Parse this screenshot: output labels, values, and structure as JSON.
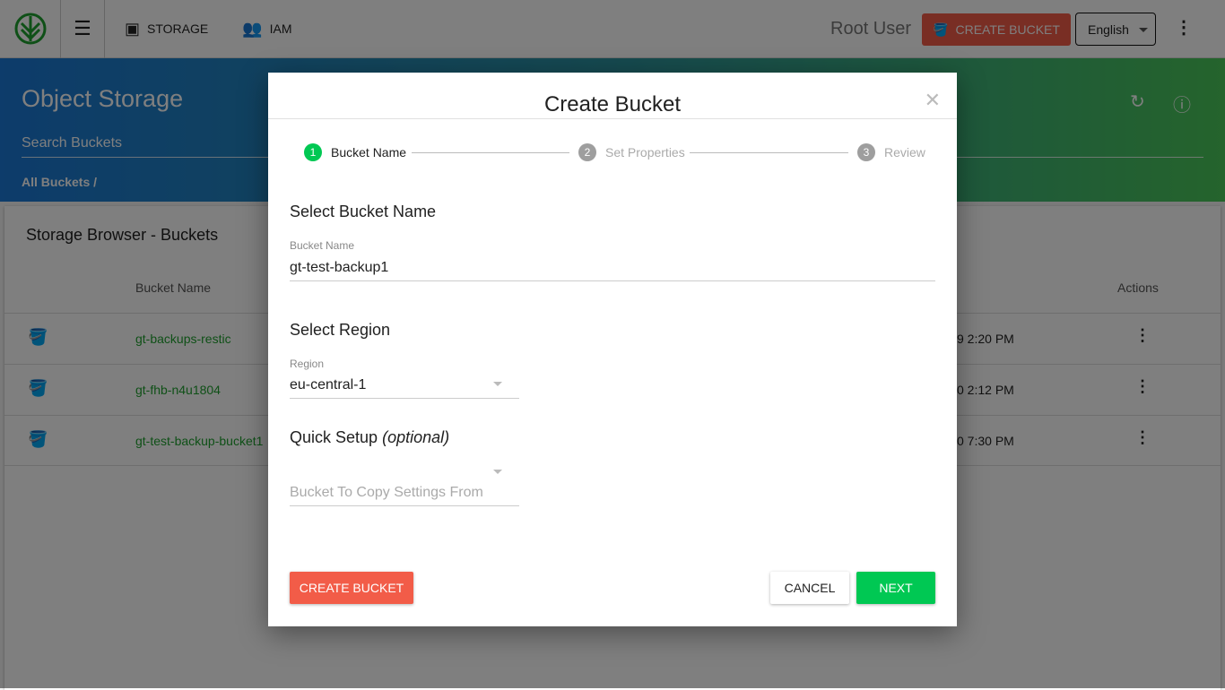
{
  "topbar": {
    "nav": [
      {
        "label": "STORAGE",
        "icon": "archive-icon"
      },
      {
        "label": "IAM",
        "icon": "people-icon"
      }
    ],
    "user": "Root User",
    "create_bucket": "CREATE BUCKET",
    "language": "English"
  },
  "hero": {
    "title": "Object Storage",
    "search_placeholder": "Search Buckets",
    "breadcrumb": "All Buckets  /"
  },
  "card": {
    "title": "Storage Browser - Buckets",
    "columns": {
      "name": "Bucket Name",
      "actions": "Actions"
    },
    "rows": [
      {
        "name": "gt-backups-restic",
        "date": "9 2:20 PM"
      },
      {
        "name": "gt-fhb-n4u1804",
        "date": "0 2:12 PM"
      },
      {
        "name": "gt-test-backup-bucket1",
        "date": "0 7:30 PM"
      }
    ]
  },
  "modal": {
    "title": "Create Bucket",
    "steps": [
      {
        "num": "1",
        "label": "Bucket Name"
      },
      {
        "num": "2",
        "label": "Set Properties"
      },
      {
        "num": "3",
        "label": "Review"
      }
    ],
    "section_name": "Select Bucket Name",
    "bucket_label": "Bucket Name",
    "bucket_value": "gt-test-backup1",
    "section_region": "Select Region",
    "region_label": "Region",
    "region_value": "eu-central-1",
    "section_quick": "Quick Setup",
    "section_quick_opt": "(optional)",
    "copy_placeholder": "Bucket To Copy Settings From",
    "create": "CREATE BUCKET",
    "cancel": "CANCEL",
    "next": "NEXT"
  },
  "colors": {
    "accent_green": "#00c853",
    "brand_red": "#f25c48"
  }
}
